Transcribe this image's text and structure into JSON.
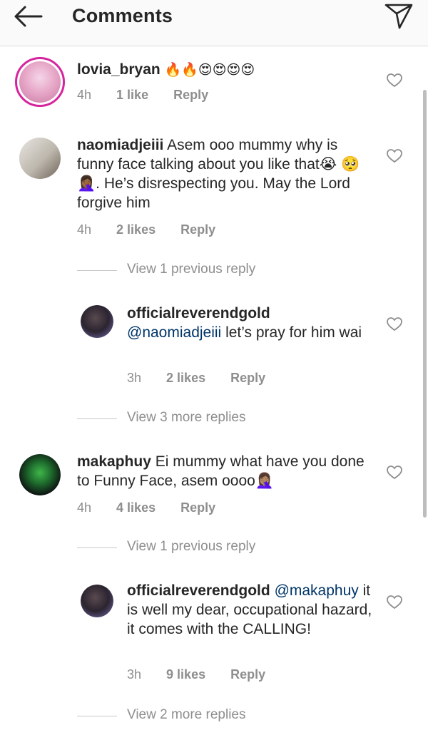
{
  "header": {
    "title": "Comments"
  },
  "comments": [
    {
      "username": "lovia_bryan",
      "text": "🔥🔥😍😍😍😍",
      "time": "4h",
      "likes": "1 like",
      "reply": "Reply"
    },
    {
      "username": "naomiadjeiii",
      "text": "Asem ooo mummy why is funny face talking about you like that😭 🥺🤦🏾‍♀️. He’s disrespecting you. May the Lord forgive him",
      "time": "4h",
      "likes": "2 likes",
      "reply": "Reply",
      "thread": "View 1 previous reply"
    },
    {
      "username": "officialreverendgold",
      "mention": "@naomiadjeiii",
      "text": "let’s pray for him wai",
      "time": "3h",
      "likes": "2 likes",
      "reply": "Reply",
      "thread": "View 3 more replies"
    },
    {
      "username": "makaphuy",
      "text": "Ei mummy what have you done to Funny Face, asem oooo🤦🏽‍♀️",
      "time": "4h",
      "likes": "4 likes",
      "reply": "Reply",
      "thread": "View 1 previous reply"
    },
    {
      "username": "officialreverendgold",
      "mention": "@makaphuy",
      "text": "it is well my dear, occupational hazard, it comes with the CALLING!",
      "time": "3h",
      "likes": "9 likes",
      "reply": "Reply",
      "thread": "View 2 more replies"
    }
  ],
  "colors": {
    "story_ring": "#d6249f",
    "mention": "#003569",
    "meta": "#8e8e8e"
  },
  "icons": {
    "back": "arrow-left-icon",
    "direct": "paper-plane-icon",
    "like": "heart-outline-icon"
  }
}
